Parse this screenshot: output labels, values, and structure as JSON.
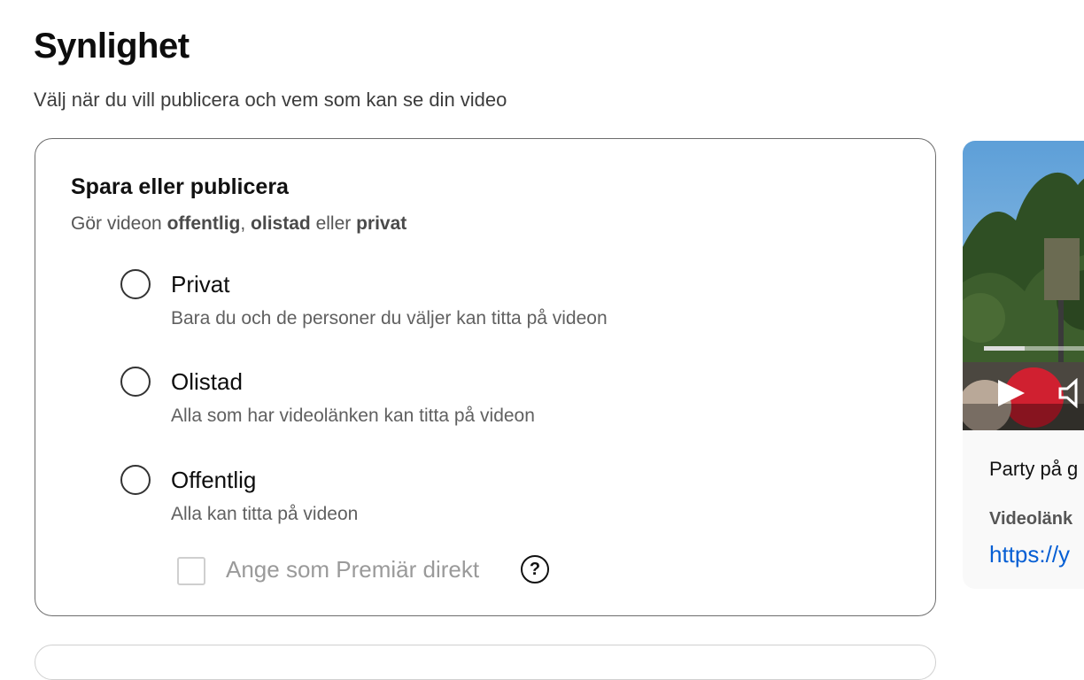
{
  "section": {
    "title": "Synlighet",
    "subtitle": "Välj när du vill publicera och vem som kan se din video"
  },
  "publish_card": {
    "title": "Spara eller publicera",
    "subtitle_parts": [
      "Gör videon ",
      "offentlig",
      ", ",
      "olistad",
      " eller ",
      "privat"
    ],
    "options": [
      {
        "label": "Privat",
        "description": "Bara du och de personer du väljer kan titta på videon",
        "selected": false
      },
      {
        "label": "Olistad",
        "description": "Alla som har videolänken kan titta på videon",
        "selected": false
      },
      {
        "label": "Offentlig",
        "description": "Alla kan titta på videon",
        "selected": false
      }
    ],
    "premiere": {
      "label": "Ange som Premiär direkt",
      "checked": false,
      "enabled": false
    },
    "help_icon": "question-circle-icon"
  },
  "preview": {
    "title": "Party på g",
    "link_label": "Videolänk",
    "link": "https://y"
  },
  "colors": {
    "link": "#065fd4",
    "card_border": "#6d6d6d"
  }
}
